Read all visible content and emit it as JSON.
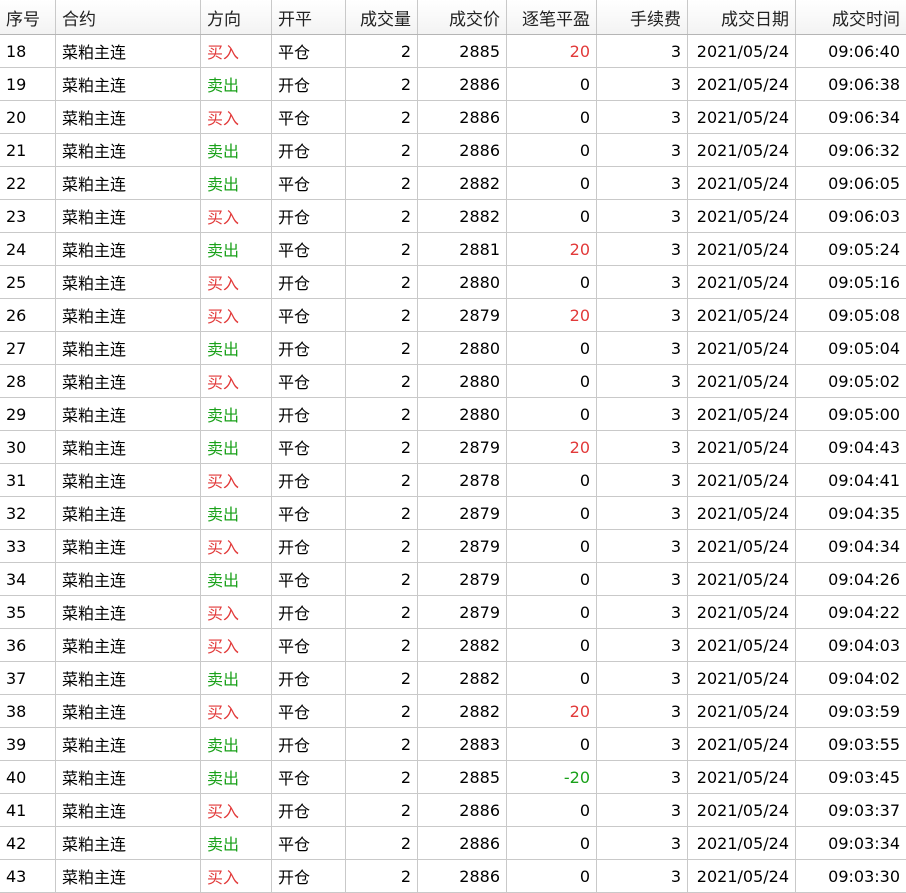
{
  "columns": [
    "序号",
    "合约",
    "方向",
    "开平",
    "成交量",
    "成交价",
    "逐笔平盈",
    "手续费",
    "成交日期",
    "成交时间"
  ],
  "colors": {
    "buy": "#e23a3a",
    "sell": "#1aa11a",
    "profit_positive": "#e23a3a",
    "profit_negative": "#1aa11a"
  },
  "rows": [
    {
      "id": "18",
      "contract": "菜粕主连",
      "direction": "买入",
      "dir_type": "buy",
      "offset": "平仓",
      "volume": "2",
      "price": "2885",
      "pnl": "20",
      "pnl_type": "pos",
      "fee": "3",
      "date": "2021/05/24",
      "time": "09:06:40"
    },
    {
      "id": "19",
      "contract": "菜粕主连",
      "direction": "卖出",
      "dir_type": "sell",
      "offset": "开仓",
      "volume": "2",
      "price": "2886",
      "pnl": "0",
      "pnl_type": "zero",
      "fee": "3",
      "date": "2021/05/24",
      "time": "09:06:38"
    },
    {
      "id": "20",
      "contract": "菜粕主连",
      "direction": "买入",
      "dir_type": "buy",
      "offset": "平仓",
      "volume": "2",
      "price": "2886",
      "pnl": "0",
      "pnl_type": "zero",
      "fee": "3",
      "date": "2021/05/24",
      "time": "09:06:34"
    },
    {
      "id": "21",
      "contract": "菜粕主连",
      "direction": "卖出",
      "dir_type": "sell",
      "offset": "开仓",
      "volume": "2",
      "price": "2886",
      "pnl": "0",
      "pnl_type": "zero",
      "fee": "3",
      "date": "2021/05/24",
      "time": "09:06:32"
    },
    {
      "id": "22",
      "contract": "菜粕主连",
      "direction": "卖出",
      "dir_type": "sell",
      "offset": "平仓",
      "volume": "2",
      "price": "2882",
      "pnl": "0",
      "pnl_type": "zero",
      "fee": "3",
      "date": "2021/05/24",
      "time": "09:06:05"
    },
    {
      "id": "23",
      "contract": "菜粕主连",
      "direction": "买入",
      "dir_type": "buy",
      "offset": "开仓",
      "volume": "2",
      "price": "2882",
      "pnl": "0",
      "pnl_type": "zero",
      "fee": "3",
      "date": "2021/05/24",
      "time": "09:06:03"
    },
    {
      "id": "24",
      "contract": "菜粕主连",
      "direction": "卖出",
      "dir_type": "sell",
      "offset": "平仓",
      "volume": "2",
      "price": "2881",
      "pnl": "20",
      "pnl_type": "pos",
      "fee": "3",
      "date": "2021/05/24",
      "time": "09:05:24"
    },
    {
      "id": "25",
      "contract": "菜粕主连",
      "direction": "买入",
      "dir_type": "buy",
      "offset": "开仓",
      "volume": "2",
      "price": "2880",
      "pnl": "0",
      "pnl_type": "zero",
      "fee": "3",
      "date": "2021/05/24",
      "time": "09:05:16"
    },
    {
      "id": "26",
      "contract": "菜粕主连",
      "direction": "买入",
      "dir_type": "buy",
      "offset": "平仓",
      "volume": "2",
      "price": "2879",
      "pnl": "20",
      "pnl_type": "pos",
      "fee": "3",
      "date": "2021/05/24",
      "time": "09:05:08"
    },
    {
      "id": "27",
      "contract": "菜粕主连",
      "direction": "卖出",
      "dir_type": "sell",
      "offset": "开仓",
      "volume": "2",
      "price": "2880",
      "pnl": "0",
      "pnl_type": "zero",
      "fee": "3",
      "date": "2021/05/24",
      "time": "09:05:04"
    },
    {
      "id": "28",
      "contract": "菜粕主连",
      "direction": "买入",
      "dir_type": "buy",
      "offset": "平仓",
      "volume": "2",
      "price": "2880",
      "pnl": "0",
      "pnl_type": "zero",
      "fee": "3",
      "date": "2021/05/24",
      "time": "09:05:02"
    },
    {
      "id": "29",
      "contract": "菜粕主连",
      "direction": "卖出",
      "dir_type": "sell",
      "offset": "开仓",
      "volume": "2",
      "price": "2880",
      "pnl": "0",
      "pnl_type": "zero",
      "fee": "3",
      "date": "2021/05/24",
      "time": "09:05:00"
    },
    {
      "id": "30",
      "contract": "菜粕主连",
      "direction": "卖出",
      "dir_type": "sell",
      "offset": "平仓",
      "volume": "2",
      "price": "2879",
      "pnl": "20",
      "pnl_type": "pos",
      "fee": "3",
      "date": "2021/05/24",
      "time": "09:04:43"
    },
    {
      "id": "31",
      "contract": "菜粕主连",
      "direction": "买入",
      "dir_type": "buy",
      "offset": "开仓",
      "volume": "2",
      "price": "2878",
      "pnl": "0",
      "pnl_type": "zero",
      "fee": "3",
      "date": "2021/05/24",
      "time": "09:04:41"
    },
    {
      "id": "32",
      "contract": "菜粕主连",
      "direction": "卖出",
      "dir_type": "sell",
      "offset": "平仓",
      "volume": "2",
      "price": "2879",
      "pnl": "0",
      "pnl_type": "zero",
      "fee": "3",
      "date": "2021/05/24",
      "time": "09:04:35"
    },
    {
      "id": "33",
      "contract": "菜粕主连",
      "direction": "买入",
      "dir_type": "buy",
      "offset": "开仓",
      "volume": "2",
      "price": "2879",
      "pnl": "0",
      "pnl_type": "zero",
      "fee": "3",
      "date": "2021/05/24",
      "time": "09:04:34"
    },
    {
      "id": "34",
      "contract": "菜粕主连",
      "direction": "卖出",
      "dir_type": "sell",
      "offset": "平仓",
      "volume": "2",
      "price": "2879",
      "pnl": "0",
      "pnl_type": "zero",
      "fee": "3",
      "date": "2021/05/24",
      "time": "09:04:26"
    },
    {
      "id": "35",
      "contract": "菜粕主连",
      "direction": "买入",
      "dir_type": "buy",
      "offset": "开仓",
      "volume": "2",
      "price": "2879",
      "pnl": "0",
      "pnl_type": "zero",
      "fee": "3",
      "date": "2021/05/24",
      "time": "09:04:22"
    },
    {
      "id": "36",
      "contract": "菜粕主连",
      "direction": "买入",
      "dir_type": "buy",
      "offset": "平仓",
      "volume": "2",
      "price": "2882",
      "pnl": "0",
      "pnl_type": "zero",
      "fee": "3",
      "date": "2021/05/24",
      "time": "09:04:03"
    },
    {
      "id": "37",
      "contract": "菜粕主连",
      "direction": "卖出",
      "dir_type": "sell",
      "offset": "开仓",
      "volume": "2",
      "price": "2882",
      "pnl": "0",
      "pnl_type": "zero",
      "fee": "3",
      "date": "2021/05/24",
      "time": "09:04:02"
    },
    {
      "id": "38",
      "contract": "菜粕主连",
      "direction": "买入",
      "dir_type": "buy",
      "offset": "平仓",
      "volume": "2",
      "price": "2882",
      "pnl": "20",
      "pnl_type": "pos",
      "fee": "3",
      "date": "2021/05/24",
      "time": "09:03:59"
    },
    {
      "id": "39",
      "contract": "菜粕主连",
      "direction": "卖出",
      "dir_type": "sell",
      "offset": "开仓",
      "volume": "2",
      "price": "2883",
      "pnl": "0",
      "pnl_type": "zero",
      "fee": "3",
      "date": "2021/05/24",
      "time": "09:03:55"
    },
    {
      "id": "40",
      "contract": "菜粕主连",
      "direction": "卖出",
      "dir_type": "sell",
      "offset": "平仓",
      "volume": "2",
      "price": "2885",
      "pnl": "-20",
      "pnl_type": "neg",
      "fee": "3",
      "date": "2021/05/24",
      "time": "09:03:45"
    },
    {
      "id": "41",
      "contract": "菜粕主连",
      "direction": "买入",
      "dir_type": "buy",
      "offset": "开仓",
      "volume": "2",
      "price": "2886",
      "pnl": "0",
      "pnl_type": "zero",
      "fee": "3",
      "date": "2021/05/24",
      "time": "09:03:37"
    },
    {
      "id": "42",
      "contract": "菜粕主连",
      "direction": "卖出",
      "dir_type": "sell",
      "offset": "平仓",
      "volume": "2",
      "price": "2886",
      "pnl": "0",
      "pnl_type": "zero",
      "fee": "3",
      "date": "2021/05/24",
      "time": "09:03:34"
    },
    {
      "id": "43",
      "contract": "菜粕主连",
      "direction": "买入",
      "dir_type": "buy",
      "offset": "开仓",
      "volume": "2",
      "price": "2886",
      "pnl": "0",
      "pnl_type": "zero",
      "fee": "3",
      "date": "2021/05/24",
      "time": "09:03:30"
    }
  ]
}
